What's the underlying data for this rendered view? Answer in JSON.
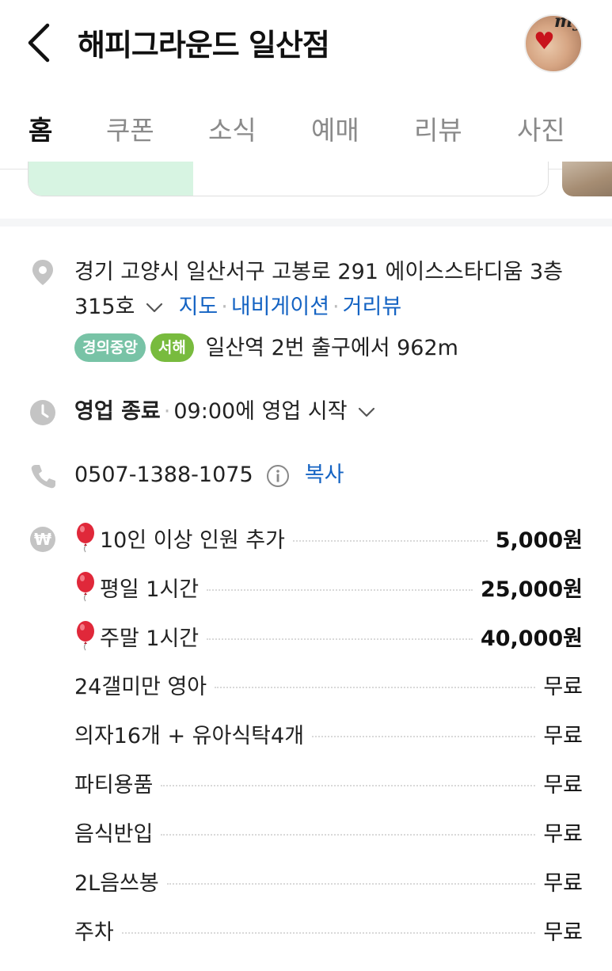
{
  "header": {
    "title": "해피그라운드 일산점",
    "avatar_text": "my"
  },
  "tabs": [
    "홈",
    "쿠폰",
    "소식",
    "예매",
    "리뷰",
    "사진"
  ],
  "address": {
    "line": "경기 고양시 일산서구 고봉로 291 에이스스타디움 3층 315호",
    "links": [
      "지도",
      "내비게이션",
      "거리뷰"
    ]
  },
  "subway": {
    "lines": [
      {
        "name": "경의중앙",
        "color": "#78c3a6"
      },
      {
        "name": "서해",
        "color": "#78bb3e"
      }
    ],
    "text": "일산역 2번 출구에서 962m"
  },
  "hours": {
    "status": "영업 종료",
    "next": "09:00에 영업 시작"
  },
  "phone": {
    "number": "0507-1388-1075",
    "copy_label": "복사"
  },
  "prices": [
    {
      "icon": "balloon",
      "label": "10인 이상 인원 추가",
      "value": "5,000원",
      "strong": true
    },
    {
      "icon": "balloon",
      "label": "평일 1시간",
      "value": "25,000원",
      "strong": true
    },
    {
      "icon": "balloon",
      "label": "주말 1시간",
      "value": "40,000원",
      "strong": true
    },
    {
      "icon": "",
      "label": "24갤미만 영아",
      "value": "무료",
      "strong": false
    },
    {
      "icon": "",
      "label": "의자16개 + 유아식탁4개",
      "value": "무료",
      "strong": false
    },
    {
      "icon": "",
      "label": "파티용품",
      "value": "무료",
      "strong": false
    },
    {
      "icon": "",
      "label": "음식반입",
      "value": "무료",
      "strong": false
    },
    {
      "icon": "",
      "label": "2L음쓰봉",
      "value": "무료",
      "strong": false
    },
    {
      "icon": "",
      "label": "주차",
      "value": "무료",
      "strong": false
    }
  ],
  "colors": {
    "link": "#1463c3",
    "icon_gray": "#c4c4c4",
    "balloon": "#e0283a"
  }
}
